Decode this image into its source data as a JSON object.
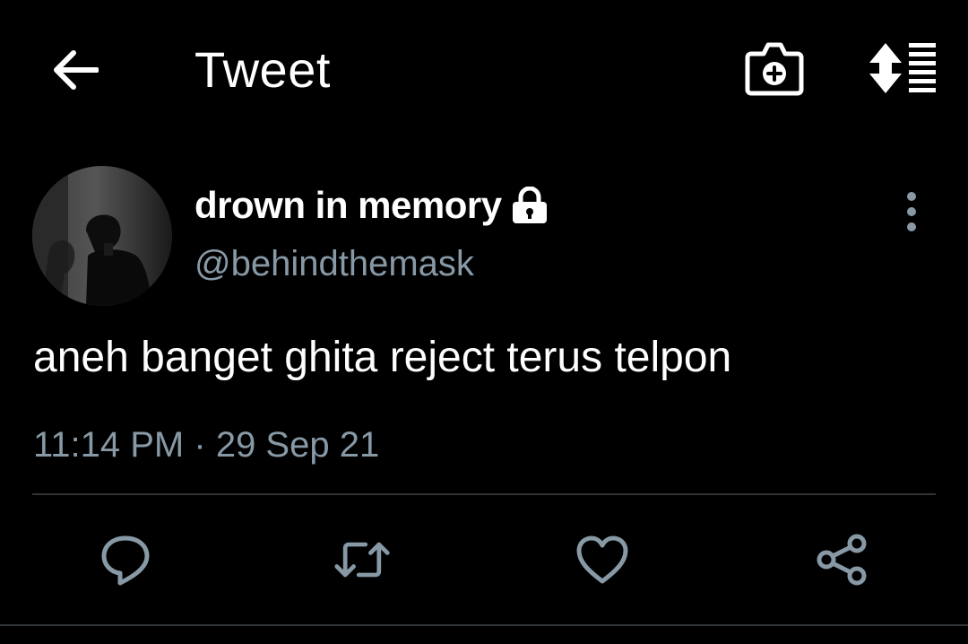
{
  "header": {
    "title": "Tweet",
    "back_icon": "arrow-left-icon",
    "camera_icon": "camera-plus-icon",
    "sort_icon": "sort-list-icon"
  },
  "tweet": {
    "author": {
      "display_name": "drown in memory",
      "handle": "@behindthemask",
      "protected_icon": "lock-icon"
    },
    "text": "aneh banget ghita reject terus telpon",
    "time": "11:14 PM",
    "separator": "·",
    "date": "29 Sep 21"
  },
  "actions": [
    {
      "name": "reply",
      "icon": "comment-icon"
    },
    {
      "name": "retweet",
      "icon": "retweet-icon"
    },
    {
      "name": "like",
      "icon": "heart-icon"
    },
    {
      "name": "share",
      "icon": "share-icon"
    }
  ],
  "colors": {
    "background": "#000000",
    "primary_text": "#ffffff",
    "secondary_text": "#8899a6",
    "divider": "#2f3336"
  }
}
